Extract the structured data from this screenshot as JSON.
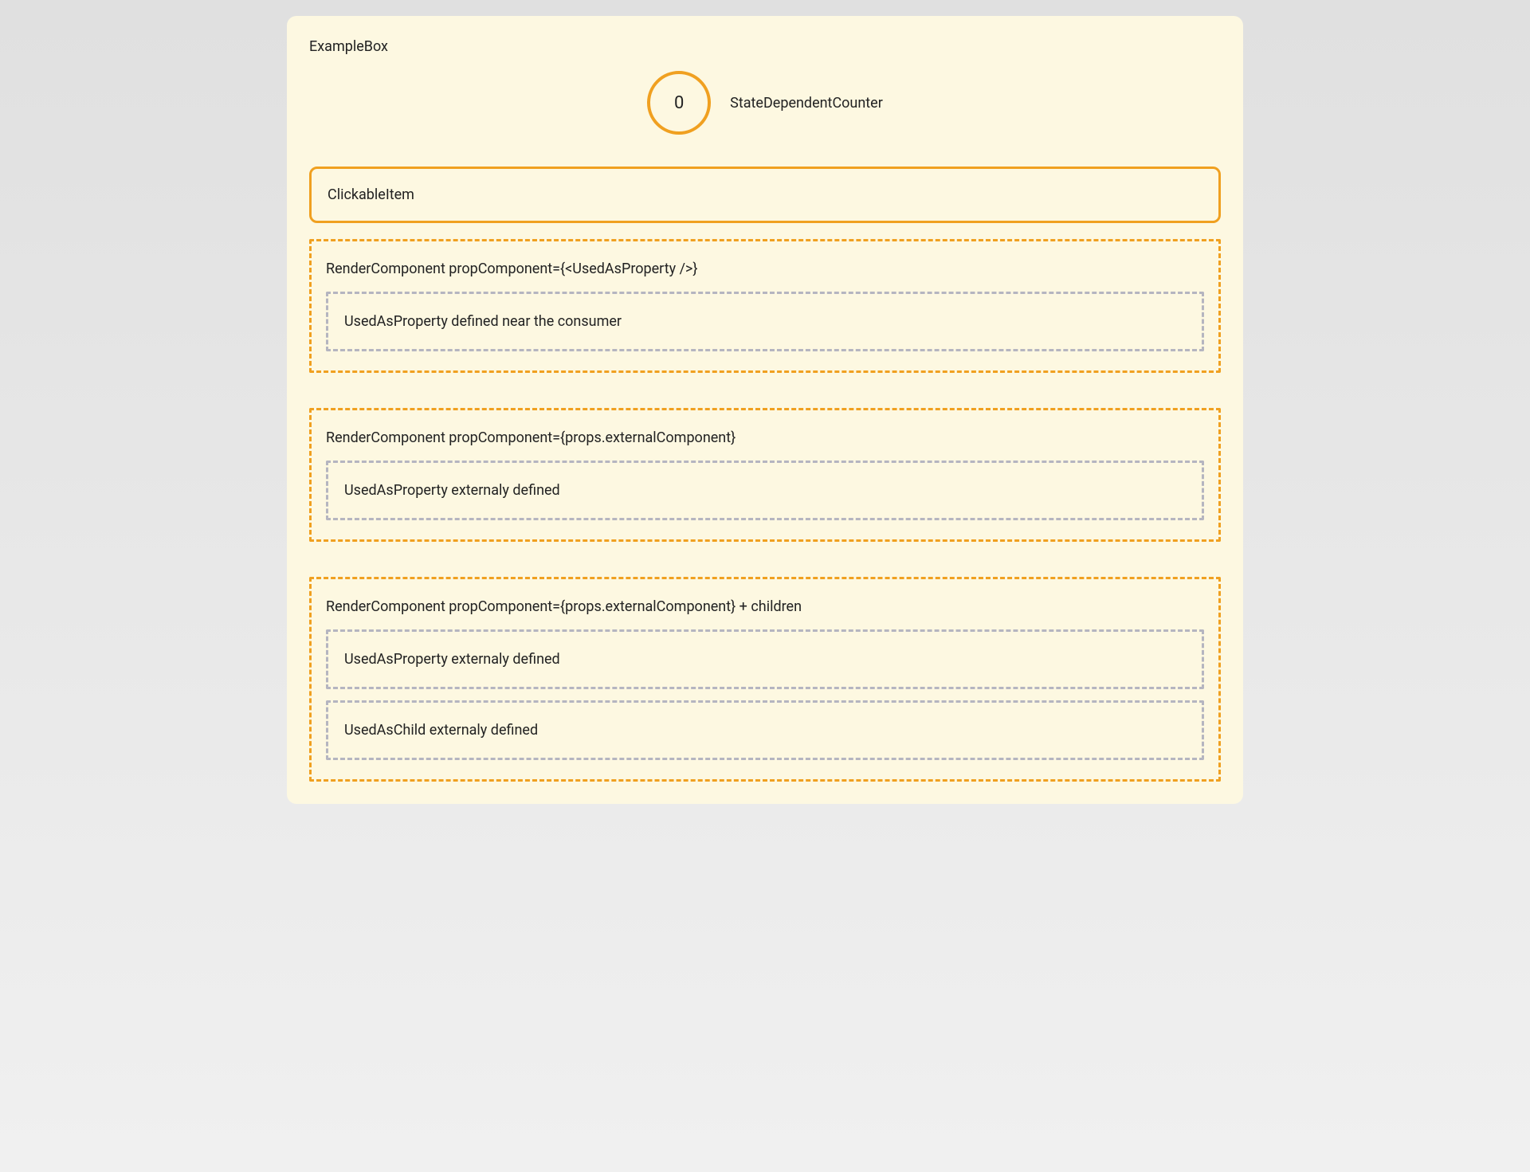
{
  "colors": {
    "accent": "#f0a020",
    "boxBg": "#fdf8e1",
    "innerDash": "#b5b5c0"
  },
  "exampleBox": {
    "title": "ExampleBox"
  },
  "counter": {
    "value": "0",
    "label": "StateDependentCounter"
  },
  "clickableItem": {
    "label": "ClickableItem"
  },
  "renderComponents": [
    {
      "title": "RenderComponent propComponent={<UsedAsProperty />}",
      "children": [
        {
          "label": "UsedAsProperty defined near the consumer"
        }
      ]
    },
    {
      "title": "RenderComponent propComponent={props.externalComponent}",
      "children": [
        {
          "label": "UsedAsProperty externaly defined"
        }
      ]
    },
    {
      "title": "RenderComponent propComponent={props.externalComponent} + children",
      "children": [
        {
          "label": "UsedAsProperty externaly defined"
        },
        {
          "label": "UsedAsChild externaly defined"
        }
      ]
    }
  ]
}
